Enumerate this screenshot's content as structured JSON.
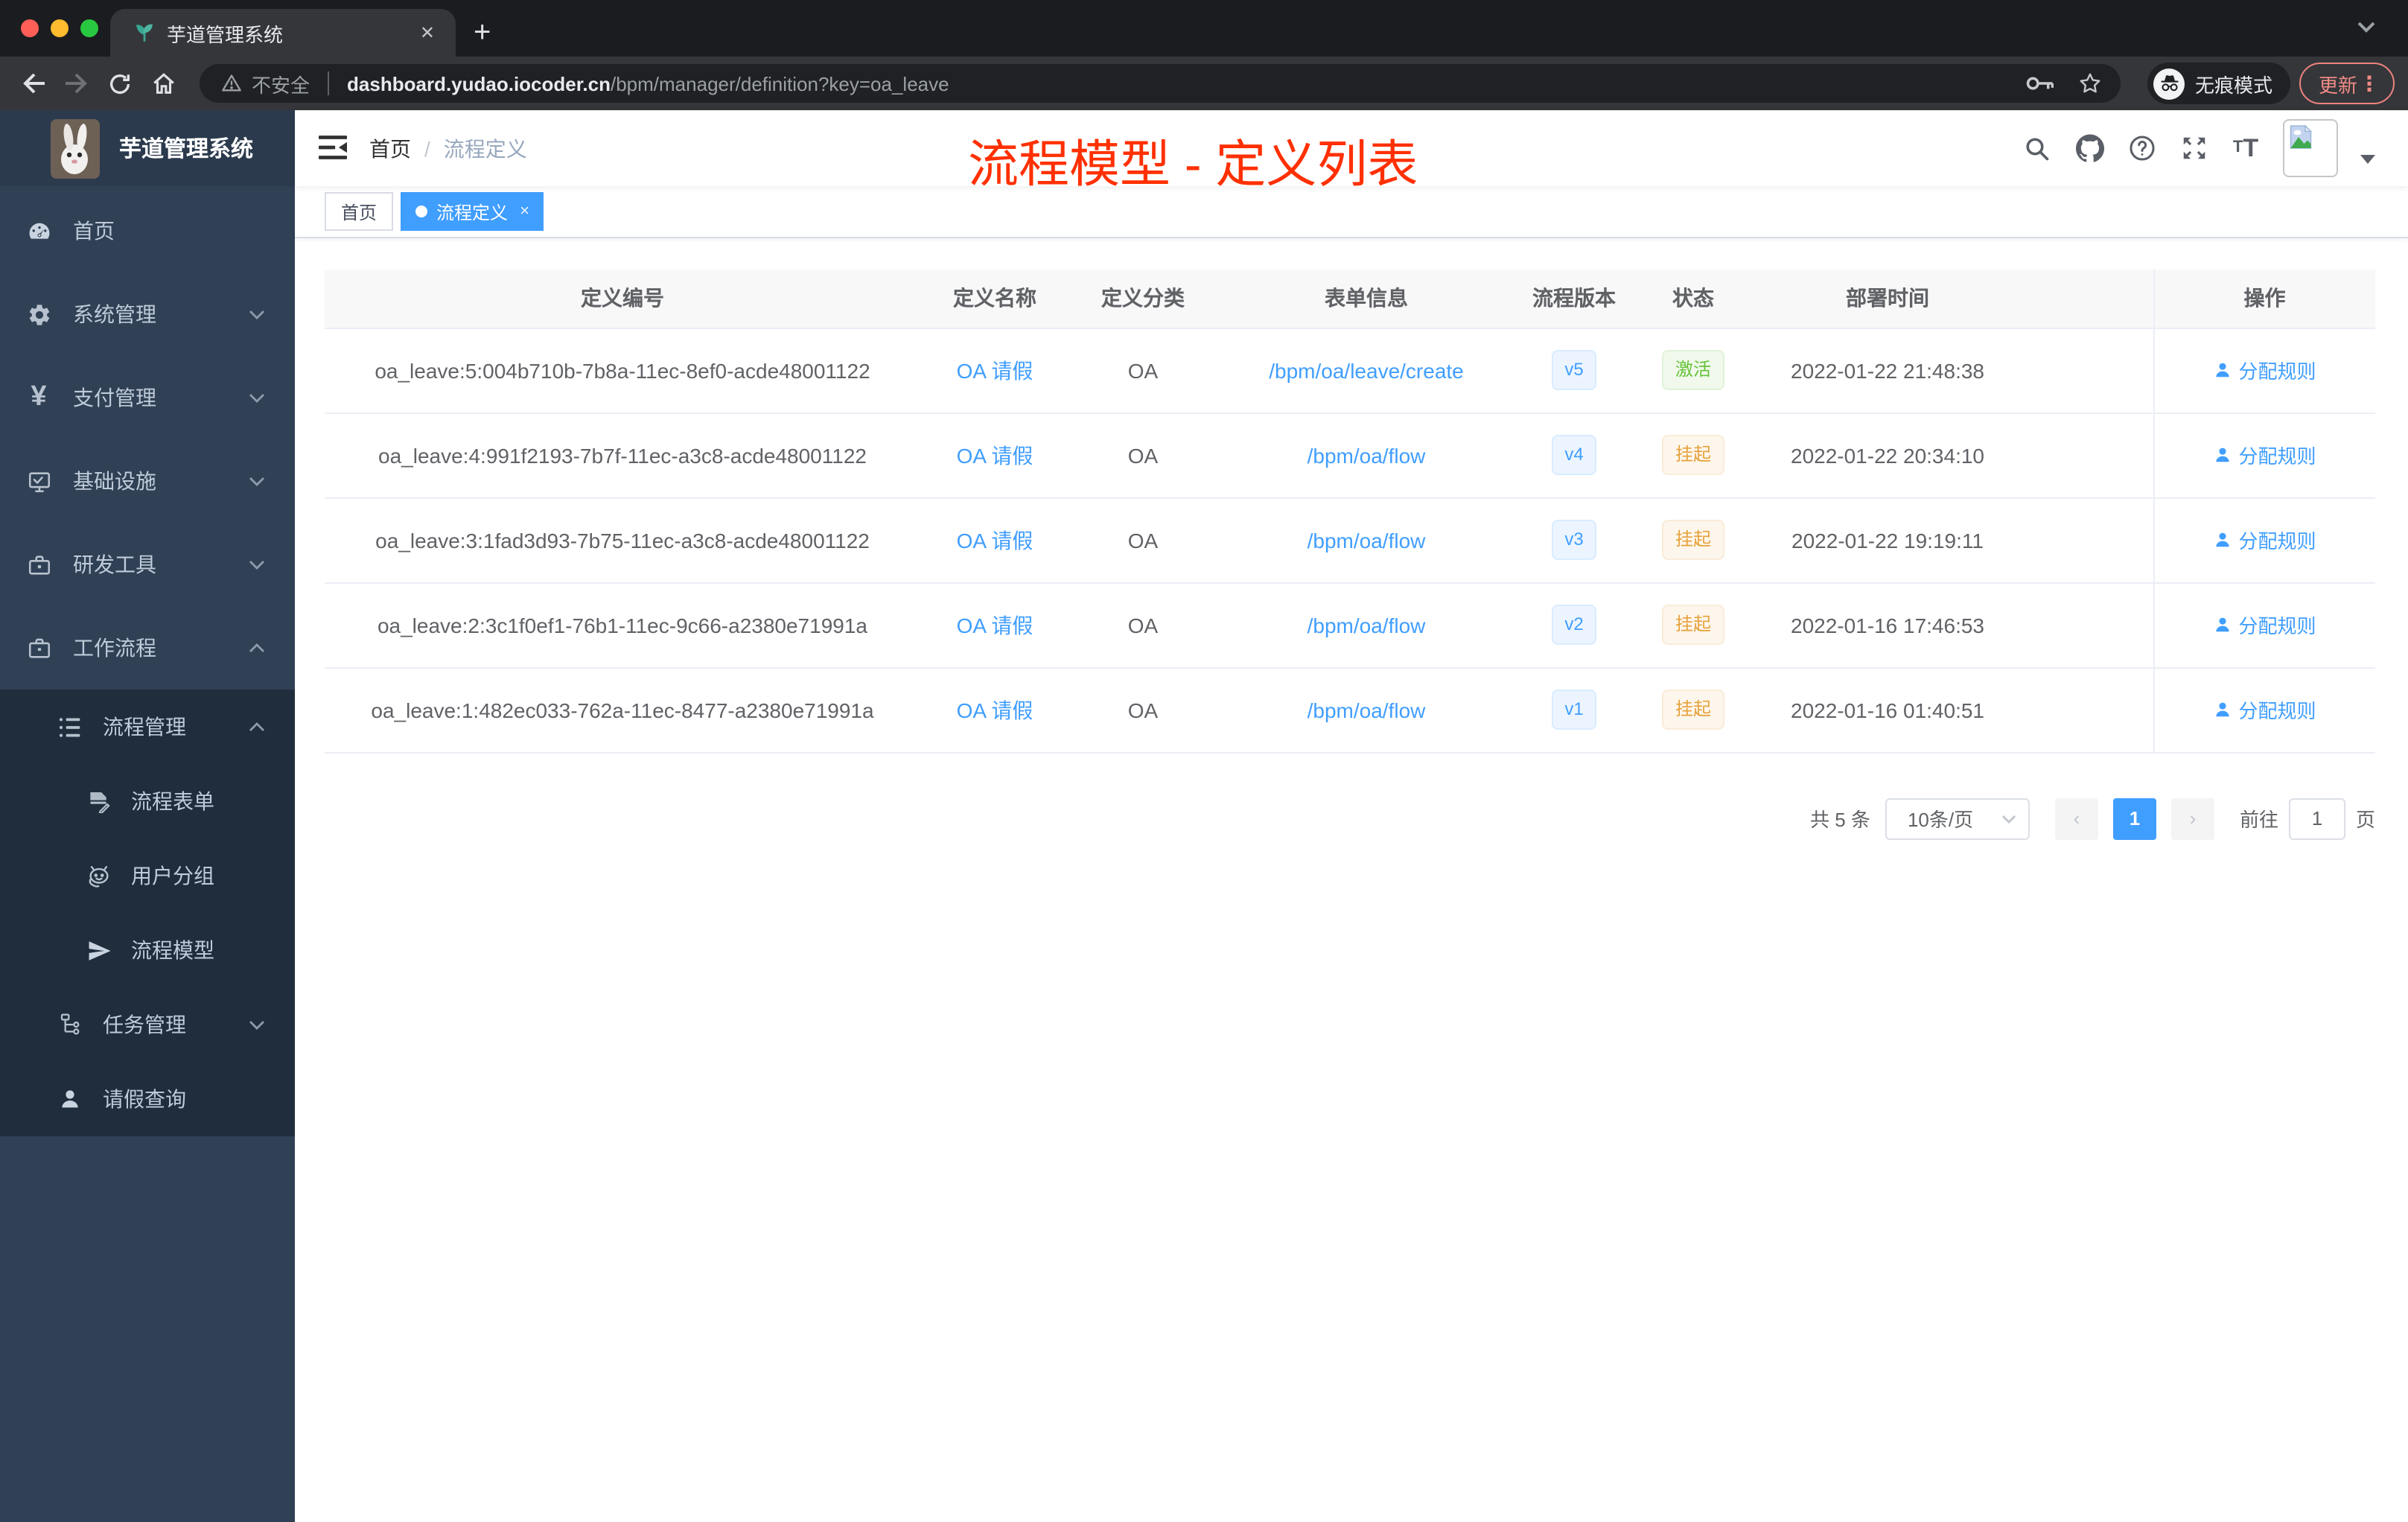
{
  "colors": {
    "accent": "#409eff",
    "annotation": "#ff3000",
    "success": "#67c23a",
    "warning": "#e6a23c",
    "sidebar_bg": "#304156",
    "submenu_bg": "#1f2d3d"
  },
  "browser": {
    "tab_title": "芋道管理系统",
    "tab_close": "✕",
    "new_tab": "+",
    "insecure_label": "不安全",
    "url_host": "dashboard.yudao.iocoder.cn",
    "url_path": "/bpm/manager/definition?key=oa_leave",
    "incognito_label": "无痕模式",
    "update_label": "更新",
    "menu_dots": "⋮"
  },
  "sidebar": {
    "logo_title": "芋道管理系统",
    "items": [
      {
        "label": "首页"
      },
      {
        "label": "系统管理"
      },
      {
        "label": "支付管理"
      },
      {
        "label": "基础设施"
      },
      {
        "label": "研发工具"
      },
      {
        "label": "工作流程"
      },
      {
        "label": "流程管理"
      },
      {
        "label": "流程表单"
      },
      {
        "label": "用户分组"
      },
      {
        "label": "流程模型"
      },
      {
        "label": "任务管理"
      },
      {
        "label": "请假查询"
      }
    ]
  },
  "header": {
    "breadcrumb_home": "首页",
    "breadcrumb_sep": "/",
    "breadcrumb_current": "流程定义",
    "annotation": "流程模型 - 定义列表"
  },
  "tags": {
    "home": "首页",
    "current": "流程定义",
    "close": "×"
  },
  "table": {
    "columns": [
      "定义编号",
      "定义名称",
      "定义分类",
      "表单信息",
      "流程版本",
      "状态",
      "部署时间",
      "操作"
    ],
    "action_label": "分配规则",
    "rows": [
      {
        "id": "oa_leave:5:004b710b-7b8a-11ec-8ef0-acde48001122",
        "name": "OA 请假",
        "category": "OA",
        "form": "/bpm/oa/leave/create",
        "version": "v5",
        "status": "激活",
        "status_type": "success",
        "deployed": "2022-01-22 21:48:38"
      },
      {
        "id": "oa_leave:4:991f2193-7b7f-11ec-a3c8-acde48001122",
        "name": "OA 请假",
        "category": "OA",
        "form": "/bpm/oa/flow",
        "version": "v4",
        "status": "挂起",
        "status_type": "warning",
        "deployed": "2022-01-22 20:34:10"
      },
      {
        "id": "oa_leave:3:1fad3d93-7b75-11ec-a3c8-acde48001122",
        "name": "OA 请假",
        "category": "OA",
        "form": "/bpm/oa/flow",
        "version": "v3",
        "status": "挂起",
        "status_type": "warning",
        "deployed": "2022-01-22 19:19:11"
      },
      {
        "id": "oa_leave:2:3c1f0ef1-76b1-11ec-9c66-a2380e71991a",
        "name": "OA 请假",
        "category": "OA",
        "form": "/bpm/oa/flow",
        "version": "v2",
        "status": "挂起",
        "status_type": "warning",
        "deployed": "2022-01-16 17:46:53"
      },
      {
        "id": "oa_leave:1:482ec033-762a-11ec-8477-a2380e71991a",
        "name": "OA 请假",
        "category": "OA",
        "form": "/bpm/oa/flow",
        "version": "v1",
        "status": "挂起",
        "status_type": "warning",
        "deployed": "2022-01-16 01:40:51"
      }
    ]
  },
  "pagination": {
    "total": "共 5 条",
    "page_size": "10条/页",
    "prev": "‹",
    "page": "1",
    "next": "›",
    "goto_label": "前往",
    "goto_value": "1",
    "unit": "页"
  }
}
